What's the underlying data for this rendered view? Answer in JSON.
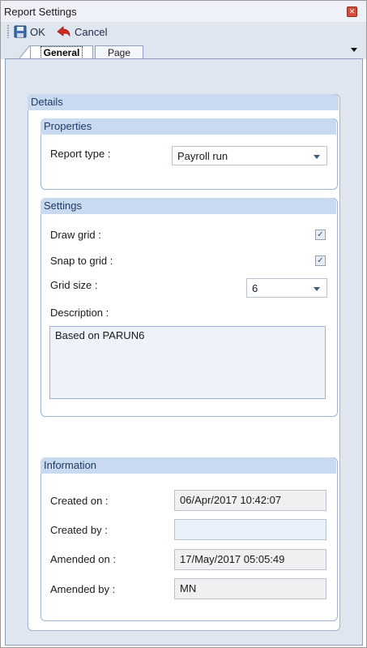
{
  "window": {
    "title": "Report Settings"
  },
  "toolbar": {
    "ok_label": "OK",
    "cancel_label": "Cancel"
  },
  "tabs": [
    {
      "label": "General",
      "active": true
    },
    {
      "label": "Page",
      "active": false
    }
  ],
  "details": {
    "header": "Details",
    "properties": {
      "header": "Properties",
      "report_type_label": "Report type :",
      "report_type_value": "Payroll run"
    },
    "settings": {
      "header": "Settings",
      "draw_grid_label": "Draw grid :",
      "draw_grid_checked": true,
      "snap_to_grid_label": "Snap to grid :",
      "snap_to_grid_checked": true,
      "grid_size_label": "Grid size :",
      "grid_size_value": "6",
      "description_label": "Description :",
      "description_value": "Based on PARUN6"
    },
    "information": {
      "header": "Information",
      "created_on_label": "Created on :",
      "created_on_value": "06/Apr/2017 10:42:07",
      "created_by_label": "Created by :",
      "created_by_value": "",
      "amended_on_label": "Amended on :",
      "amended_on_value": "17/May/2017 05:05:49",
      "amended_by_label": "Amended by :",
      "amended_by_value": "MN"
    }
  },
  "colors": {
    "header_bg": "#c9daf0",
    "panel_bg": "#dfe6f0",
    "accent": "#1d3b66"
  },
  "icons": {
    "ok": "save-icon",
    "cancel": "cancel-arrow-icon",
    "close": "close-icon"
  }
}
